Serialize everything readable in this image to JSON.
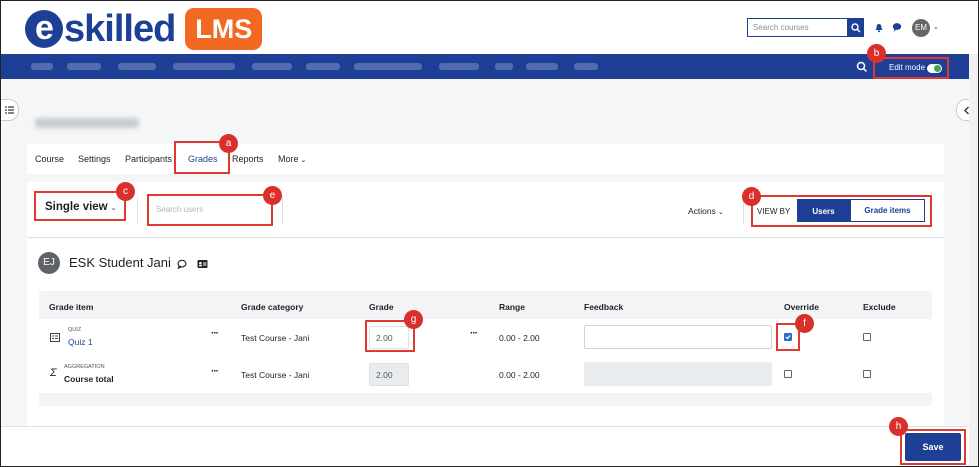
{
  "header": {
    "logo_text": "eskilled",
    "logo_badge": "LMS",
    "search_placeholder": "Search courses",
    "avatar_initials": "EM"
  },
  "navbar": {
    "edit_mode_label": "Edit mode",
    "edit_mode_on": true
  },
  "tabs": [
    {
      "label": "Course"
    },
    {
      "label": "Settings"
    },
    {
      "label": "Participants"
    },
    {
      "label": "Grades",
      "active": true
    },
    {
      "label": "Reports"
    },
    {
      "label": "More"
    }
  ],
  "toolbar": {
    "single_view_label": "Single view",
    "search_users_placeholder": "Search users",
    "actions_label": "Actions",
    "view_by_label": "VIEW BY",
    "view_by_users": "Users",
    "view_by_grade_items": "Grade items"
  },
  "student": {
    "initials": "EJ",
    "name": "ESK Student Jani"
  },
  "table": {
    "headers": {
      "grade_item": "Grade item",
      "grade_category": "Grade category",
      "grade": "Grade",
      "range": "Range",
      "feedback": "Feedback",
      "override": "Override",
      "exclude": "Exclude"
    },
    "rows": [
      {
        "type_label": "QUIZ",
        "item": "Quiz 1",
        "category": "Test Course - Jani",
        "grade": "2.00",
        "range": "0.00 - 2.00",
        "override": true,
        "exclude": false
      },
      {
        "type_label": "AGGREGATION",
        "item": "Course total",
        "category": "Test Course - Jani",
        "grade": "2.00",
        "range": "0.00 - 2.00",
        "override": false,
        "exclude": false
      }
    ]
  },
  "footer": {
    "save_label": "Save"
  },
  "callouts": {
    "a": "a",
    "b": "b",
    "c": "c",
    "d": "d",
    "e": "e",
    "f": "f",
    "g": "g",
    "h": "h"
  },
  "colors": {
    "brand_blue": "#1d3f95",
    "brand_orange": "#f26a21",
    "callout_red": "#d9302b"
  }
}
